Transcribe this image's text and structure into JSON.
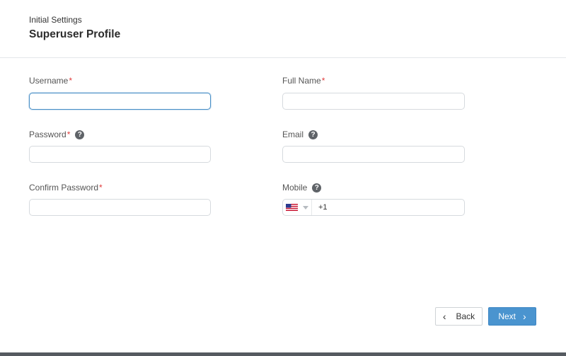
{
  "header": {
    "subtitle": "Initial Settings",
    "title": "Superuser Profile"
  },
  "form": {
    "username": {
      "label": "Username",
      "required": "*",
      "value": "",
      "placeholder": ""
    },
    "full_name": {
      "label": "Full Name",
      "required": "*",
      "value": "",
      "placeholder": ""
    },
    "password": {
      "label": "Password",
      "required": "*",
      "help": "?",
      "value": ""
    },
    "email": {
      "label": "Email",
      "help": "?",
      "value": ""
    },
    "confirm_password": {
      "label": "Confirm Password",
      "required": "*",
      "value": ""
    },
    "mobile": {
      "label": "Mobile",
      "help": "?",
      "country_flag": "us-flag-icon",
      "dial_code": "+1"
    }
  },
  "actions": {
    "back_label": "Back",
    "next_label": "Next"
  },
  "colors": {
    "accent": "#4a94cf",
    "required": "#e03b3b",
    "focus_border": "#4a90c7"
  }
}
